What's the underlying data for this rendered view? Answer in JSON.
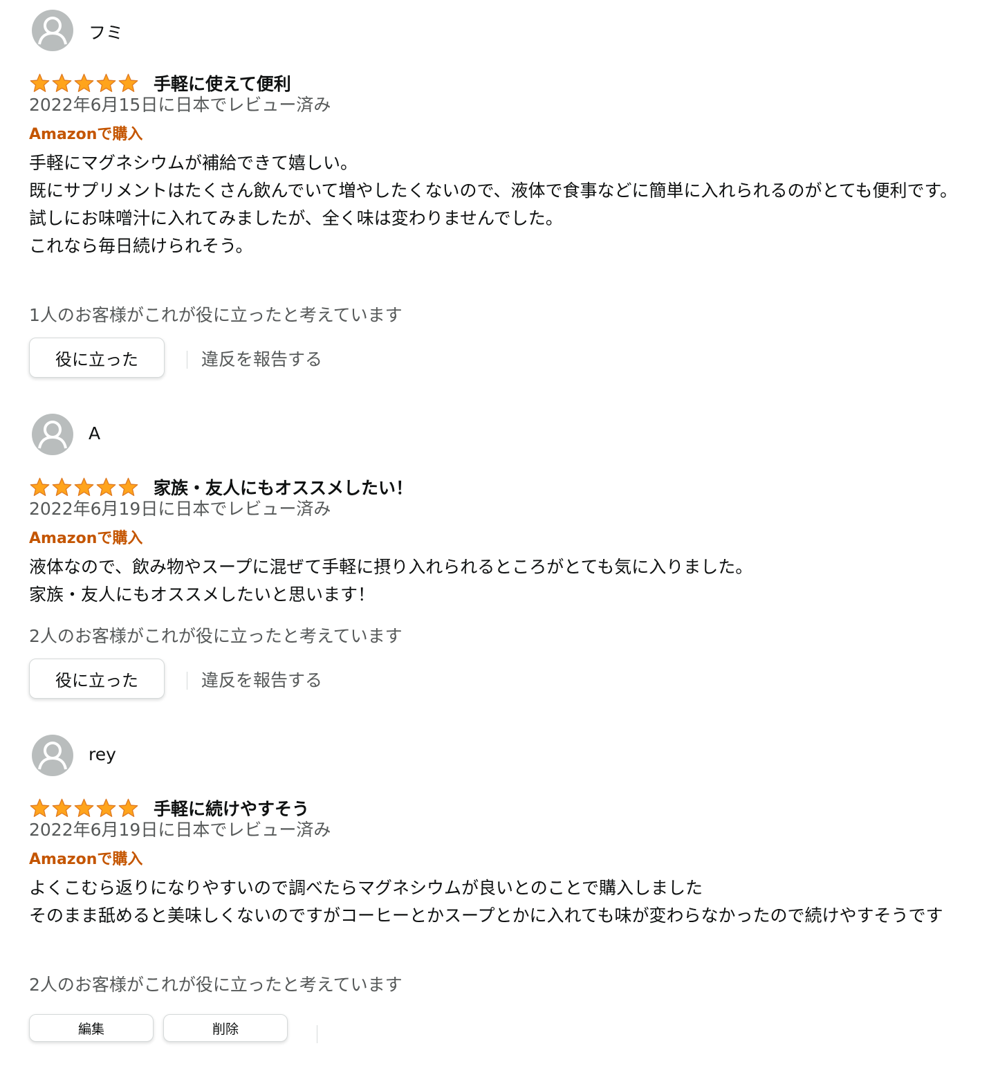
{
  "colors": {
    "star": "#ffa41c",
    "star_stroke": "#de7921",
    "verified": "#c45500",
    "secondary_text": "#565959",
    "primary_text": "#0f1111",
    "avatar_bg": "#b9bdbd"
  },
  "reviews": [
    {
      "reviewer": "フミ",
      "rating": 5,
      "title": "手軽に使えて便利",
      "date": "2022年6月15日に日本でレビュー済み",
      "verified": "Amazonで購入",
      "body": [
        "手軽にマグネシウムが補給できて嬉しい。",
        "既にサプリメントはたくさん飲んでいて増やしたくないので、液体で食事などに簡単に入れられるのがとても便利です。",
        "試しにお味噌汁に入れてみましたが、全く味は変わりませんでした。",
        "これなら毎日続けられそう。"
      ],
      "helpful_count": "1人のお客様がこれが役に立ったと考えています",
      "helpful_button": "役に立った",
      "report_link": "違反を報告する"
    },
    {
      "reviewer": "A",
      "rating": 5,
      "title": "家族・友人にもオススメしたい！",
      "date": "2022年6月19日に日本でレビュー済み",
      "verified": "Amazonで購入",
      "body": [
        "液体なので、飲み物やスープに混ぜて手軽に摂り入れられるところがとても気に入りました。",
        "家族・友人にもオススメしたいと思います！"
      ],
      "helpful_count": "2人のお客様がこれが役に立ったと考えています",
      "helpful_button": "役に立った",
      "report_link": "違反を報告する"
    },
    {
      "reviewer": "rey",
      "rating": 5,
      "title": "手軽に続けやすそう",
      "date": "2022年6月19日に日本でレビュー済み",
      "verified": "Amazonで購入",
      "body": [
        "よくこむら返りになりやすいので調べたらマグネシウムが良いとのことで購入しました",
        "そのまま舐めると美味しくないのですがコーヒーとかスープとかに入れても味が変わらなかったので続けやすそうです"
      ],
      "helpful_count": "2人のお客様がこれが役に立ったと考えています",
      "edit_button": "編集",
      "delete_button": "削除"
    }
  ]
}
